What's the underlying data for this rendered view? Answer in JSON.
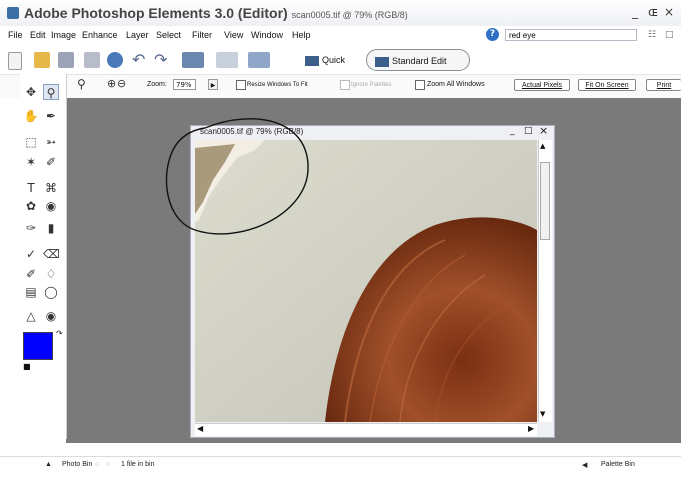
{
  "titlebar": {
    "app_name": "Adobe Photoshop Elements 3.0 (Editor)",
    "doc_subtitle": "scan0005.tif @ 79% (RGB/8)",
    "controls": [
      "_",
      "ɶ",
      "×"
    ]
  },
  "menu": [
    "File",
    "Edit",
    "Image",
    "Enhance",
    "Layer",
    "Select",
    "Filter",
    "View",
    "Window",
    "Help"
  ],
  "help_search": {
    "value": "red eye"
  },
  "modes": {
    "quick_fix": "Quick Fix",
    "standard_edit": "Standard Edit"
  },
  "options": {
    "zoom_label": "Zoom:",
    "zoom_value": "79%",
    "resize_windows": "Resize Windows To Fit",
    "ignore_palettes": "Ignore Palettes",
    "zoom_all": "Zoom All Windows",
    "actual_pixels": "Actual Pixels",
    "fit_on_screen": "Fit On Screen",
    "print": "Print"
  },
  "document": {
    "title": "scan0005.tif @ 79% (RGB/8)"
  },
  "status": {
    "photo_bin": "Photo Bin",
    "files_count": "1 file in bin",
    "palette_bin": "Palette Bin"
  },
  "colors": {
    "foreground": "#0000ff",
    "background": "#ffffff",
    "hair": "#8a3e1c",
    "annotation": "#111111"
  }
}
